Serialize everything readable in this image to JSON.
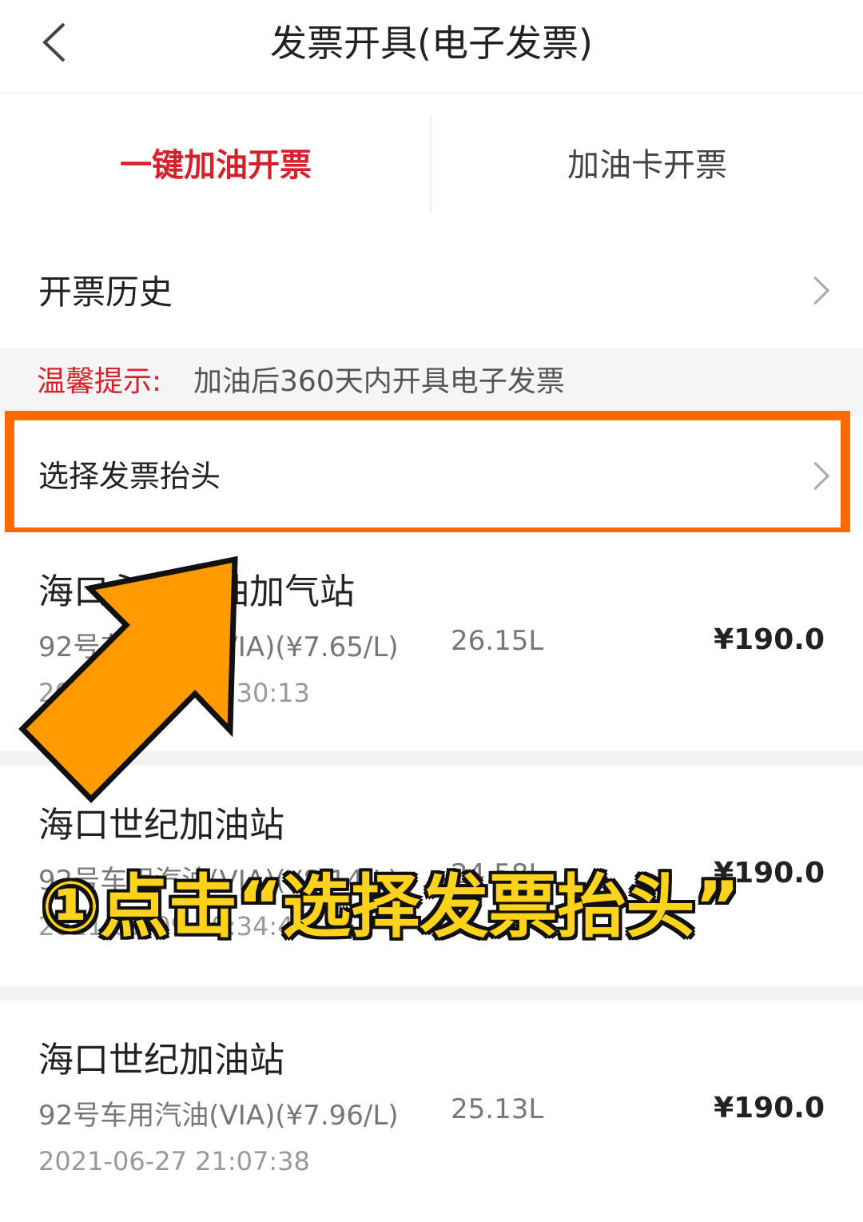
{
  "header": {
    "title": "发票开具(电子发票)",
    "back_icon": "chevron-left-icon"
  },
  "tabs": [
    {
      "label": "一键加油开票",
      "active": true
    },
    {
      "label": "加油卡开票",
      "active": false
    }
  ],
  "history": {
    "label": "开票历史"
  },
  "tip": {
    "label": "温馨提示:",
    "text": "加油后360天内开具电子发票"
  },
  "select_header": {
    "label": "选择发票抬头"
  },
  "records": [
    {
      "station": "海口永正加油加气站",
      "fuel": "92号车用汽油(VIA)(¥7.65/L)",
      "liters": "26.15L",
      "amount": "¥190.0",
      "time": "2021-07-18 10:30:13"
    },
    {
      "station": "海口世纪加油站",
      "fuel": "92号车用汽油(VIA)(¥8.14/L)",
      "liters": "24.58L",
      "amount": "¥190.0",
      "time": "2021-07-09 19:34:49"
    },
    {
      "station": "海口世纪加油站",
      "fuel": "92号车用汽油(VIA)(¥7.96/L)",
      "liters": "25.13L",
      "amount": "¥190.0",
      "time": "2021-06-27 21:07:38"
    }
  ],
  "annotation": {
    "caption": "①点击“选择发票抬头”"
  },
  "colors": {
    "accent": "#d8202a",
    "highlight": "#ff6a00",
    "arrow": "#ff9a00",
    "caption": "#ffd21c"
  }
}
